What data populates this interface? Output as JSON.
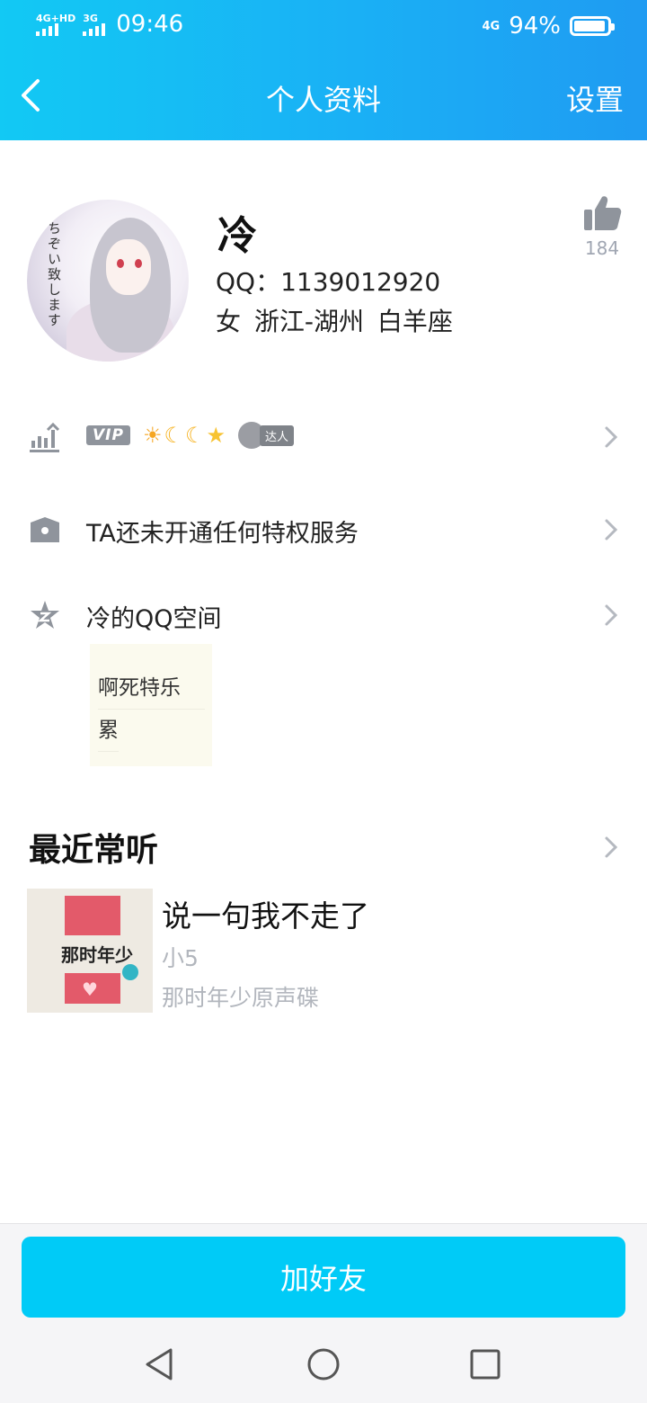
{
  "status_bar": {
    "signal1_label": "4G+HD",
    "signal2_label": "3G",
    "time": "09:46",
    "network": "4G",
    "battery": "94%",
    "battery_level": 0.94
  },
  "header": {
    "title": "个人资料",
    "settings_label": "设置",
    "back_icon": "chevron-left-icon"
  },
  "profile": {
    "name": "冷",
    "qq_line": "QQ：1139012920",
    "info_line": "女 浙江-湖州 白羊座",
    "like_count": "184",
    "avatar_text": "ちぞい致します"
  },
  "rows": {
    "level": {
      "icon": "level-chart-icon",
      "vip_label": "VIP",
      "expert_label": "达人"
    },
    "privilege": {
      "icon": "crown-icon",
      "label": "TA还未开通任何特权服务"
    },
    "qzone": {
      "icon": "qzone-star-icon",
      "label": "冷的QQ空间",
      "note_lines": [
        "啊死特乐",
        "累"
      ]
    }
  },
  "recent": {
    "title": "最近常听",
    "song": "说一句我不走了",
    "artist": "小5",
    "album": "那时年少原声碟",
    "album_cover_title": "那时年少"
  },
  "bottom": {
    "add_friend_label": "加好友",
    "nav": [
      "back-nav-icon",
      "home-nav-icon",
      "recents-nav-icon"
    ]
  },
  "colors": {
    "header_start": "#12c9f4",
    "header_end": "#1f9bf2",
    "button": "#00cbf7",
    "icon_gray": "#8f949c"
  }
}
